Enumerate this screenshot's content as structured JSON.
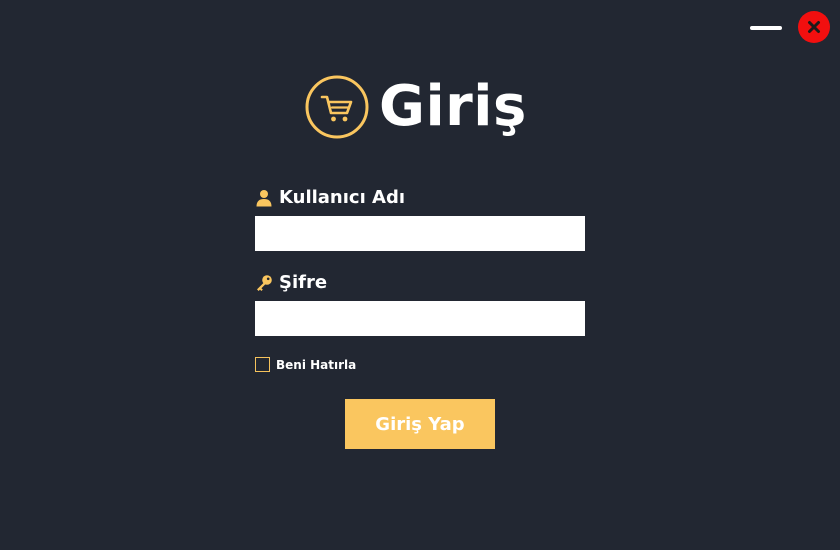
{
  "window_controls": {
    "minimize_icon": "minimize-icon",
    "close_icon": "close-x-icon",
    "close_color": "#f20f0f"
  },
  "header": {
    "logo_icon": "shopping-cart-icon",
    "title": "Giriş",
    "accent_color": "#fac65f"
  },
  "form": {
    "username": {
      "icon": "user-icon",
      "label": "Kullanıcı Adı",
      "value": ""
    },
    "password": {
      "icon": "key-icon",
      "label": "Şifre",
      "value": ""
    },
    "remember_me": {
      "label": "Beni Hatırla",
      "checked": false
    },
    "submit_label": "Giriş Yap"
  },
  "colors": {
    "background": "#222732",
    "button": "#fac65f",
    "text": "#ffffff"
  }
}
